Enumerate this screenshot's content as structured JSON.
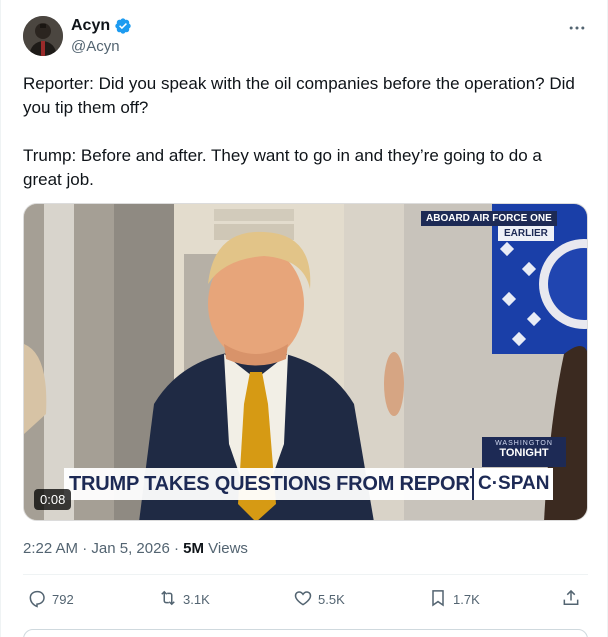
{
  "author": {
    "display_name": "Acyn",
    "handle": "@Acyn",
    "verified": true
  },
  "tweet": {
    "text": "Reporter: Did you speak with the oil companies before the operation? Did you tip them off?\n\nTrump: Before and after. They want to go in and they’re going to do a great job."
  },
  "media": {
    "duration": "0:08",
    "chyron": "TRUMP TAKES QUESTIONS FROM REPORTERS",
    "network": "C·SPAN",
    "tag_top": "ABOARD AIR FORCE ONE",
    "tag_earlier": "EARLIER",
    "tag_location": "WASHINGTON",
    "tag_tonight": "TONIGHT"
  },
  "meta": {
    "time": "2:22 AM",
    "sep": "·",
    "date": "Jan 5, 2026",
    "views_count": "5M",
    "views_label": "Views"
  },
  "actions": {
    "replies": "792",
    "reposts": "3.1K",
    "likes": "5.5K",
    "bookmarks": "1.7K"
  },
  "colors": {
    "verified": "#1d9bf0",
    "text_secondary": "#536471",
    "chyron_navy": "#1d2a55"
  },
  "icons": [
    "verified-badge-icon",
    "more-icon",
    "reply-icon",
    "repost-icon",
    "like-icon",
    "bookmark-icon",
    "share-icon"
  ]
}
